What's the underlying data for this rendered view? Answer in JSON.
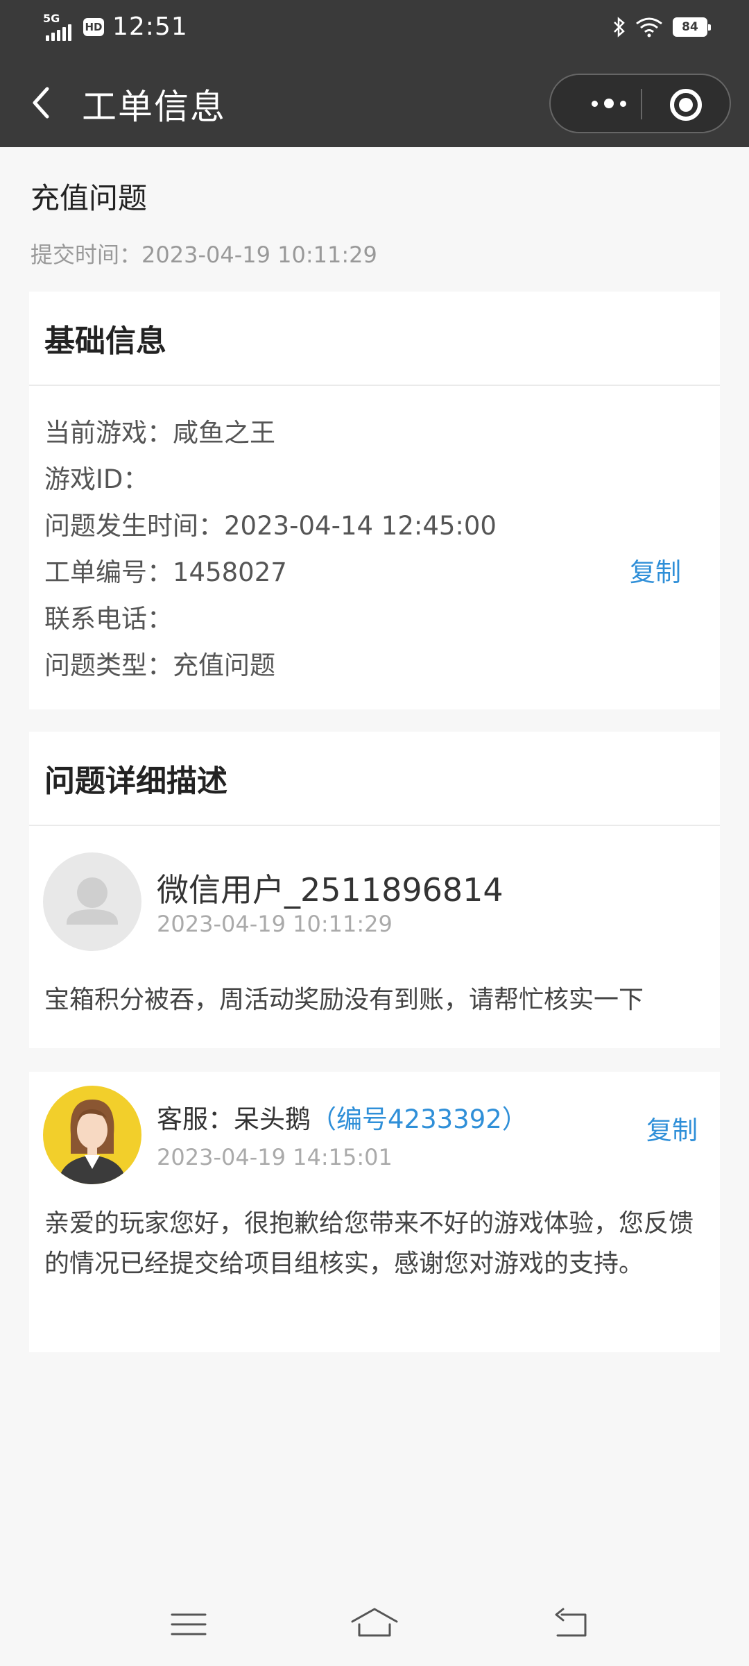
{
  "status_bar": {
    "network": "5G",
    "hd": "HD",
    "time": "12:51",
    "battery": "84",
    "icons": [
      "signal-icon",
      "bluetooth-icon",
      "wifi-icon",
      "battery-icon"
    ]
  },
  "navbar": {
    "title": "工单信息",
    "icons": [
      "back-icon",
      "more-icon",
      "record-icon"
    ]
  },
  "ticket": {
    "title": "充值问题",
    "submit_label": "提交时间：",
    "submit_time": "2023-04-19 10:11:29"
  },
  "basic_info": {
    "heading": "基础信息",
    "rows": [
      {
        "label": "当前游戏：",
        "value": "咸鱼之王"
      },
      {
        "label": "游戏ID：",
        "value": ""
      },
      {
        "label": "问题发生时间：",
        "value": "2023-04-14 12:45:00"
      },
      {
        "label": "工单编号：",
        "value": "1458027"
      },
      {
        "label": "联系电话：",
        "value": ""
      },
      {
        "label": "问题类型：",
        "value": "充值问题"
      }
    ],
    "copy_label": "复制"
  },
  "detail": {
    "heading": "问题详细描述",
    "user_message": {
      "name": "微信用户_2511896814",
      "time": "2023-04-19 10:11:29",
      "text": "宝箱积分被吞，周活动奖励没有到账，请帮忙核实一下"
    },
    "cs_message": {
      "name": "客服：呆头鹅",
      "id_label": "（编号4233392）",
      "time": "2023-04-19 14:15:01",
      "copy_label": "复制",
      "text": "亲爱的玩家您好，很抱歉给您带来不好的游戏体验，您反馈的情况已经提交给项目组核实，感谢您对游戏的支持。"
    }
  },
  "bottom_nav": {
    "icons": [
      "menu-icon",
      "home-icon",
      "back-nav-icon"
    ]
  },
  "colors": {
    "topbar": "#3a3a3a",
    "link": "#2f8fd8",
    "background": "#f7f7f7"
  }
}
